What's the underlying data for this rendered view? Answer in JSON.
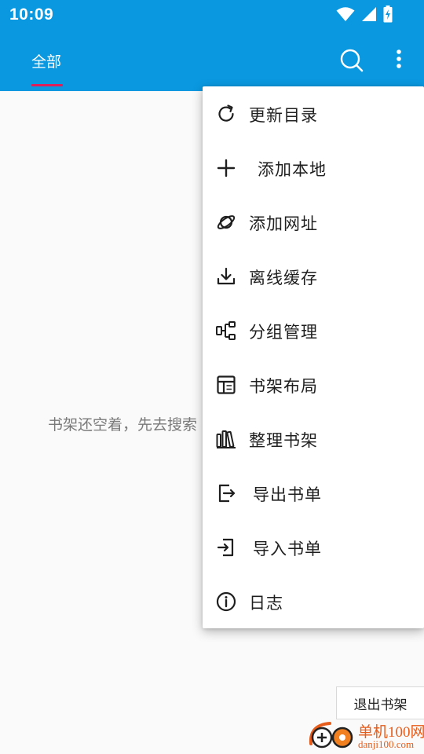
{
  "status_bar": {
    "time": "10:09"
  },
  "app_bar": {
    "tab_label": "全部"
  },
  "empty_state": {
    "message": "书架还空着，先去搜索"
  },
  "menu": {
    "items": [
      {
        "label": "更新目录",
        "icon": "refresh-icon"
      },
      {
        "label": "添加本地",
        "icon": "plus-icon"
      },
      {
        "label": "添加网址",
        "icon": "planet-icon"
      },
      {
        "label": "离线缓存",
        "icon": "download-icon"
      },
      {
        "label": "分组管理",
        "icon": "group-icon"
      },
      {
        "label": "书架布局",
        "icon": "layout-icon"
      },
      {
        "label": "整理书架",
        "icon": "books-icon"
      },
      {
        "label": "导出书单",
        "icon": "export-icon"
      },
      {
        "label": "导入书单",
        "icon": "import-icon"
      },
      {
        "label": "日志",
        "icon": "info-icon"
      }
    ]
  },
  "exit_button": {
    "label": "退出书架"
  },
  "watermark": {
    "name": "单机100网",
    "url": "danji100.com"
  },
  "colors": {
    "primary": "#0a98e0",
    "tab_indicator": "#e01e5a",
    "watermark": "#e65c1a"
  }
}
